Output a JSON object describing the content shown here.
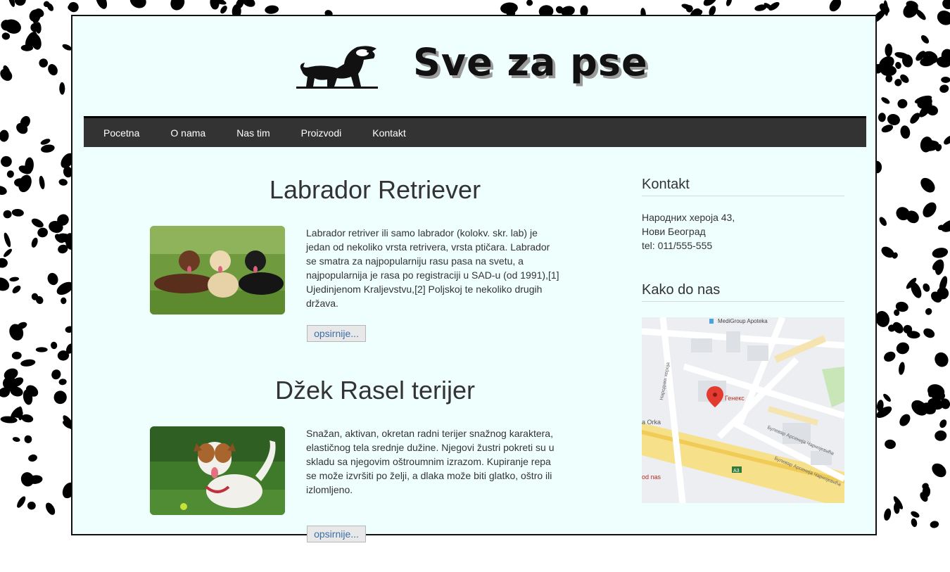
{
  "site": {
    "title": "Sve za pse"
  },
  "nav": {
    "items": [
      "Pocetna",
      "O nama",
      "Nas tim",
      "Proizvodi",
      "Kontakt"
    ]
  },
  "articles": [
    {
      "title": "Labrador Retriever",
      "text": "Labrador retriver ili samo labrador (kolokv. skr. lab) je jedan od nekoliko vrsta retrivera, vrsta ptičara. Labrador se smatra za najpopularniju rasu pasa na svetu, a najpopularnija je rasa po registraciji u SAD-u (od 1991),[1] Ujedinjenom Kraljevstvu,[2] Poljskoj te nekoliko drugih država.",
      "more_label": "opsirnije..."
    },
    {
      "title": "Džek Rasel terijer",
      "text": "Snažan, aktivan, okretan radni terijer snažnog karaktera, elastičnog tela srednje dužine. Njegovi žustri pokreti su u skladu sa njegovim oštroumnim izrazom. Kupiranje repa se može izvršiti po želji, a dlaka može biti glatko, oštro ili izlomljeno.",
      "more_label": "opsirnije..."
    }
  ],
  "sidebar": {
    "contact": {
      "title": "Kontakt",
      "address1": "Народних хероја 43,",
      "address2": "Нови Београд",
      "phone": "tel: 011/555-555"
    },
    "directions": {
      "title": "Kako do nas"
    },
    "map": {
      "labels": {
        "pharmacy": "MediGroup Apoteka",
        "street1": "Народних хероја",
        "place": "Генекс",
        "street2": "Булевар Арсенија Чарнојевића",
        "street3": "Булевар Арсенија Чарнојевића",
        "orka": "a Orka",
        "road": "A3",
        "dnas": "od nas"
      }
    }
  },
  "colors": {
    "nav_bg": "#333333",
    "page_bg": "#effffe",
    "link": "#3a6ea8"
  }
}
